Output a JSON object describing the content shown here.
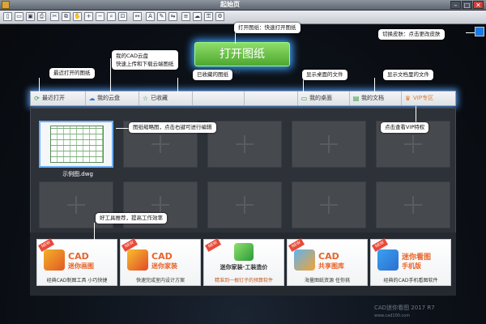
{
  "titlebar": {
    "title": "起始页",
    "min": "–",
    "max": "□",
    "close": "✕"
  },
  "toolbar": {
    "icons": [
      "new-file-icon",
      "open-folder-icon",
      "save-icon",
      "print-icon",
      "cut-icon",
      "copy-icon",
      "pan-icon",
      "zoom-in-icon",
      "zoom-out-icon",
      "zoom-window-icon",
      "zoom-extents-icon",
      "measure-icon",
      "text-icon",
      "pencil-icon",
      "compare-icon",
      "layer-icon",
      "cloud-icon",
      "lock-icon",
      "settings-icon"
    ]
  },
  "main": {
    "open_button": "打开图纸",
    "faint_version": "2017 R7"
  },
  "nav": {
    "recent": "最近打开",
    "cloud": "我的云盘",
    "favorites": "已收藏",
    "desktop": "我的桌面",
    "documents": "我的文档",
    "vip": "VIP专区"
  },
  "thumb": {
    "filename": "示例图.dwg"
  },
  "tools": [
    {
      "name": "CAD",
      "sub": "迷你画图",
      "desc": "经典CAD制图工具 小巧快捷",
      "color": "#e8642a"
    },
    {
      "name": "CAD",
      "sub": "迷你家装",
      "desc": "快速完成室内设计方案",
      "color": "#e8642a"
    },
    {
      "name": "迷你家装·工装造价",
      "sub": "",
      "desc": "精准到一根钉子的预算软件",
      "color": "#3a3a3a"
    },
    {
      "name": "CAD",
      "sub": "共享图库",
      "desc": "海量图纸资源 任你挑",
      "color": "#e8642a"
    },
    {
      "name": "迷你看图",
      "sub": "手机版",
      "desc": "经典的CAD手机看图软件",
      "color": "#e8642a"
    }
  ],
  "tips": {
    "open": "打开图纸：快速打开图纸",
    "skin": "切换皮肤：点击更改皮肤",
    "cloud": "我的CAD云盘\n快速上传和下载云端图纸",
    "recent": "最近打开的图纸",
    "favorites": "已收藏的图纸",
    "desktop": "显示桌面的文件",
    "documents": "显示文档里的文件",
    "thumb": "图纸缩略图，点击右键可进行编辑",
    "vip": "点击查看VIP特权",
    "tools": "好工具推荐，提高工作效率"
  },
  "footer": {
    "text": "CAD迷你看图  2017 R7",
    "url": "www.cad100.com"
  }
}
